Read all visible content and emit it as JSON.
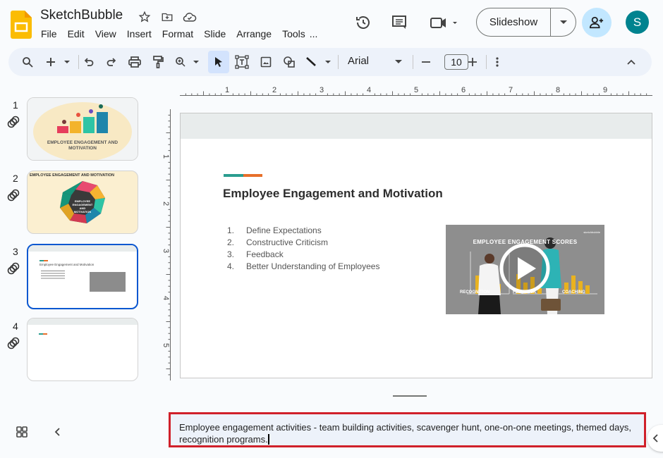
{
  "app": {
    "doc_title": "SketchBubble",
    "menu": [
      "File",
      "Edit",
      "View",
      "Insert",
      "Format",
      "Slide",
      "Arrange",
      "Tools",
      "..."
    ],
    "slideshow_label": "Slideshow",
    "avatar_initial": "S",
    "accent_color": "#0b57d0"
  },
  "toolbar": {
    "font_name": "Arial",
    "font_size": "10"
  },
  "rulers": {
    "horizontal_labels": [
      "1",
      "2",
      "3",
      "4",
      "5",
      "6",
      "7",
      "8",
      "9"
    ],
    "vertical_labels": [
      "1",
      "2",
      "3",
      "4",
      "5"
    ]
  },
  "filmstrip": {
    "slides": [
      {
        "number": "1",
        "thumb_title": "EMPLOYEE ENGAGEMENT AND MOTIVATION"
      },
      {
        "number": "2",
        "thumb_title": "EMPLOYEE ENGAGEMENT AND MOTIVATION",
        "thumb_center": "EMPLOYEE ENGAGEMENT AND MOTIVATION"
      },
      {
        "number": "3",
        "thumb_title": "Employee Engagement and Motivation",
        "selected": true
      },
      {
        "number": "4"
      }
    ]
  },
  "slide": {
    "title": "Employee Engagement and Motivation",
    "list": [
      {
        "num": "1.",
        "text": "Define Expectations"
      },
      {
        "num": "2.",
        "text": "Constructive Criticism"
      },
      {
        "num": "3.",
        "text": "Feedback"
      },
      {
        "num": "4.",
        "text": "Better Understanding of Employees"
      }
    ],
    "video": {
      "heading": "EMPLOYEE ENGAGEMENT SCORES",
      "labels": [
        "RECOGNITION",
        "FEEDBACK",
        "COACHING"
      ],
      "watermark": "sketchbubble"
    }
  },
  "notes": {
    "text": "Employee engagement activities - team building activities, scavenger hunt, one-on-one meetings, themed days, recognition programs."
  }
}
